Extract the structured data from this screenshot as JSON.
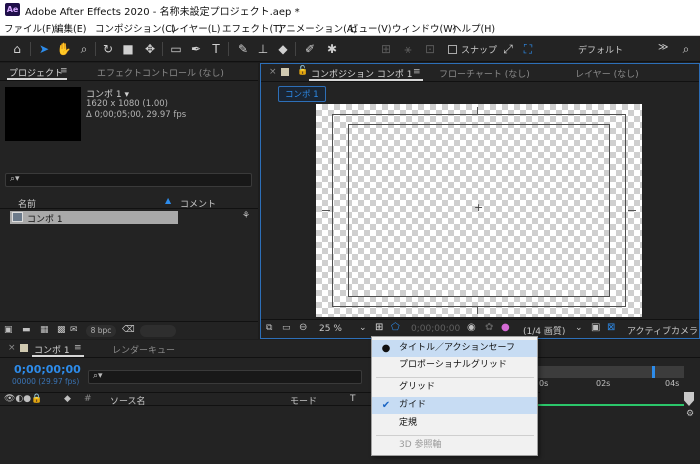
{
  "window": {
    "title": "Adobe After Effects 2020 - 名称未設定プロジェクト.aep *",
    "logo": "Ae"
  },
  "menu": [
    "ファイル(F)",
    "編集(E)",
    "コンポジション(C)",
    "レイヤー(L)",
    "エフェクト(T)",
    "アニメーション(A)",
    "ビュー(V)",
    "ウィンドウ(W)",
    "ヘルプ(H)"
  ],
  "toolbar": {
    "snap_label": "スナップ",
    "workspace_label": "デフォルト",
    "more": "≫"
  },
  "project_panel": {
    "tabs": [
      "プロジェクト",
      "エフェクトコントロール (なし)"
    ],
    "comp_name": "コンポ 1 ▾",
    "comp_size": "1620 x 1080 (1.00)",
    "comp_duration": "Δ 0;00;05;00, 29.97 fps",
    "search_icon": "search-icon",
    "col_name": "名前",
    "col_comment": "コメント",
    "item_name": "コンポ 1",
    "bpc": "8 bpc"
  },
  "viewer_panel": {
    "tabs": [
      "コンポジション コンポ 1",
      "フローチャート (なし)",
      "レイヤー (なし)"
    ],
    "comp_chip": "コンポ 1",
    "zoom": "25 %",
    "timecode": "0;00;00;00",
    "resolution": "(1/4 画質)",
    "camera": "アクティブカメラ"
  },
  "dropdown": {
    "items": [
      {
        "label": "タイトル／アクションセーフ",
        "mark": "●",
        "highlight": true,
        "disabled": false
      },
      {
        "label": "プロポーショナルグリッド",
        "mark": "",
        "highlight": false,
        "disabled": false
      },
      {
        "label": "グリッド",
        "mark": "",
        "highlight": false,
        "disabled": false
      },
      {
        "label": "ガイド",
        "mark": "✔",
        "highlight": true,
        "disabled": false
      },
      {
        "label": "定規",
        "mark": "",
        "highlight": false,
        "disabled": false
      },
      {
        "label": "3D 参照軸",
        "mark": "",
        "highlight": false,
        "disabled": true
      }
    ]
  },
  "timeline_panel": {
    "tabs": [
      "コンポ 1",
      "レンダーキュー"
    ],
    "timecode": "0;00;00;00",
    "timecode_sub": "00000 (29.97 fps)",
    "col_source": "ソース名",
    "col_mode": "モード",
    "col_t": "T",
    "ruler": [
      "0s",
      "02s",
      "04s"
    ]
  },
  "colors": {
    "accent": "#2d8ceb",
    "panel": "#232323",
    "bg": "#1d1d1d",
    "menu_hl": "#c7dcf3"
  }
}
